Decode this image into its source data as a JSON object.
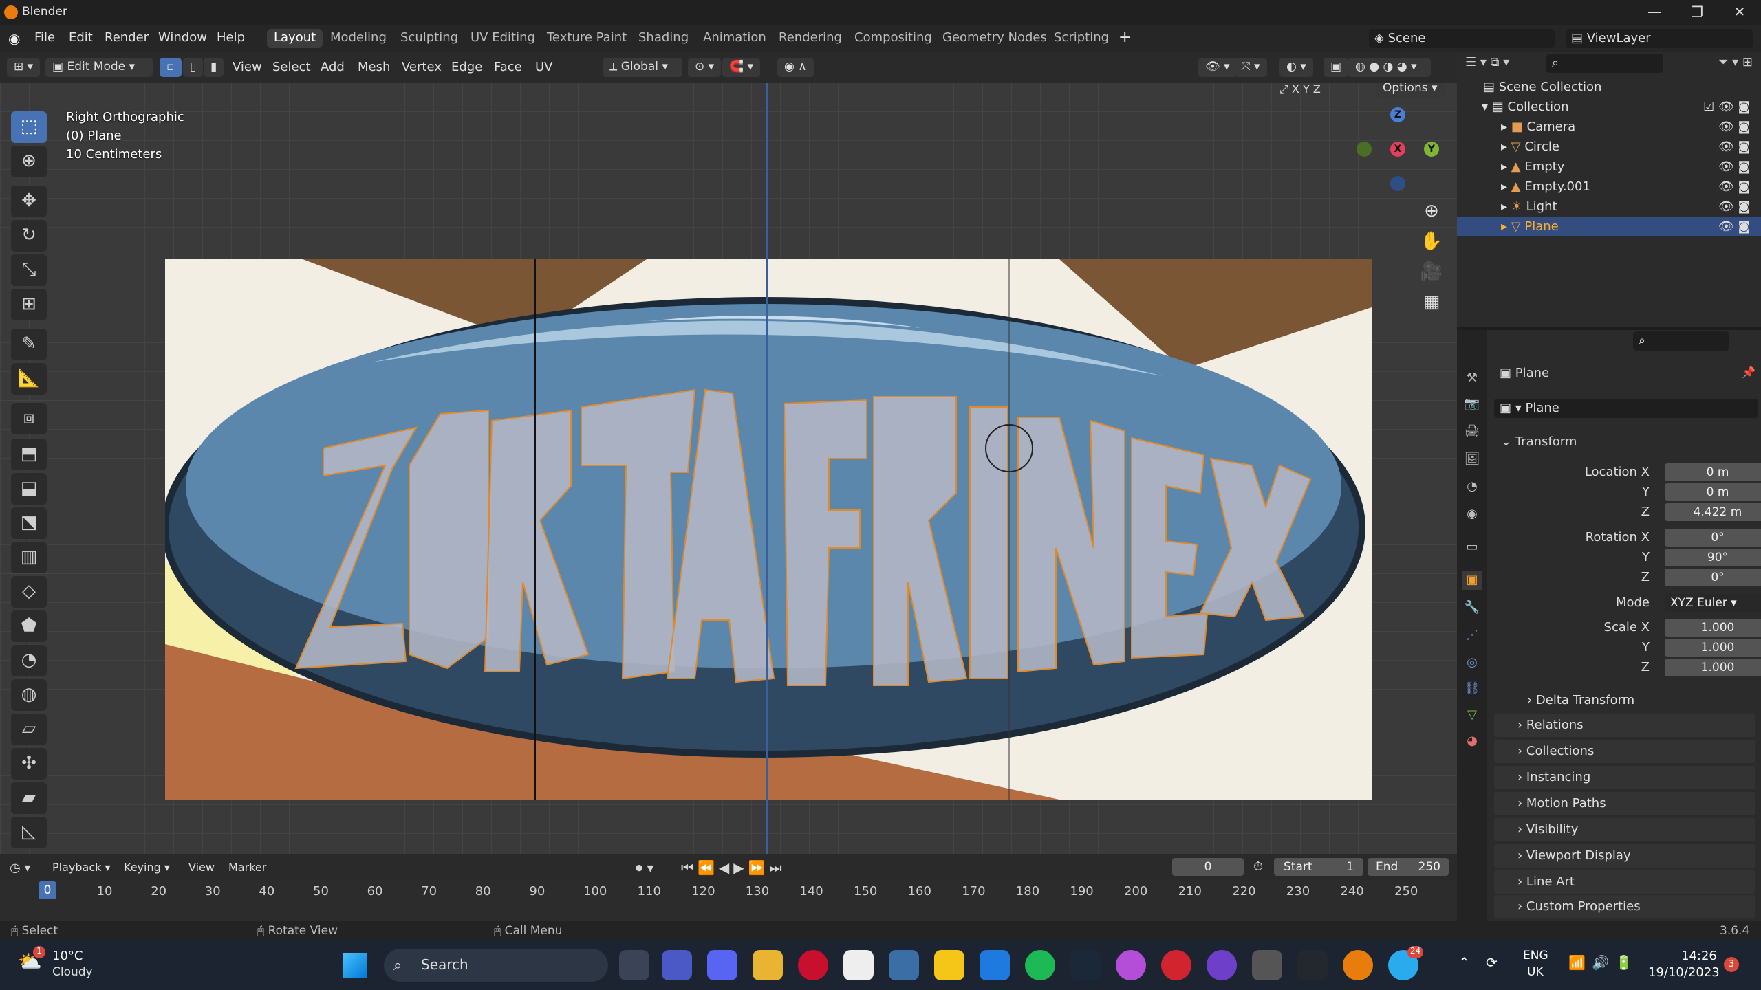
{
  "window": {
    "title": "Blender",
    "controls": [
      "—",
      "❐",
      "✕"
    ]
  },
  "menu": {
    "items": [
      "File",
      "Edit",
      "Render",
      "Window",
      "Help"
    ],
    "workspaces": [
      "Layout",
      "Modeling",
      "Sculpting",
      "UV Editing",
      "Texture Paint",
      "Shading",
      "Animation",
      "Rendering",
      "Compositing",
      "Geometry Nodes",
      "Scripting"
    ],
    "add": "+",
    "scene": "Scene",
    "view_layer": "ViewLayer"
  },
  "viewport_header": {
    "mode": "Edit Mode",
    "menus": [
      "View",
      "Select",
      "Add",
      "Mesh",
      "Vertex",
      "Edge",
      "Face",
      "UV"
    ],
    "orientation": "Global",
    "options": "Options",
    "axes": [
      "X",
      "Y",
      "Z"
    ]
  },
  "viewport": {
    "view_name": "Right Orthographic",
    "object": "(0) Plane",
    "scale": "10 Centimeters",
    "ref_text": "ZORTAFRINEX",
    "gizmo": {
      "z": "Z",
      "x": "X",
      "y": "Y"
    }
  },
  "outliner": {
    "root": "Scene Collection",
    "collection": "Collection",
    "objects": [
      {
        "name": "Camera",
        "icon": "camera-icon"
      },
      {
        "name": "Circle",
        "icon": "mesh-icon"
      },
      {
        "name": "Empty",
        "icon": "empty-icon"
      },
      {
        "name": "Empty.001",
        "icon": "empty-icon"
      },
      {
        "name": "Light",
        "icon": "light-icon"
      },
      {
        "name": "Plane",
        "icon": "mesh-icon",
        "selected": true
      }
    ]
  },
  "properties": {
    "object_name": "Plane",
    "data_name": "Plane",
    "transform": {
      "title": "Transform",
      "location": {
        "label": "Location X",
        "x": "0 m",
        "y": "0 m",
        "z": "4.422 m"
      },
      "rotation": {
        "label": "Rotation X",
        "x": "0°",
        "y": "90°",
        "z": "0°"
      },
      "mode_label": "Mode",
      "mode": "XYZ Euler",
      "scale": {
        "label": "Scale X",
        "x": "1.000",
        "y": "1.000",
        "z": "1.000"
      },
      "y_label": "Y",
      "z_label": "Z"
    },
    "panels": [
      "Delta Transform",
      "Relations",
      "Collections",
      "Instancing",
      "Motion Paths",
      "Visibility",
      "Viewport Display",
      "Line Art",
      "Custom Properties"
    ]
  },
  "timeline": {
    "menus": [
      "Playback",
      "Keying",
      "View",
      "Marker"
    ],
    "current": "0",
    "start_label": "Start",
    "start": "1",
    "end_label": "End",
    "end": "250",
    "ticks": [
      "0",
      "10",
      "20",
      "30",
      "40",
      "50",
      "60",
      "70",
      "80",
      "90",
      "100",
      "110",
      "120",
      "130",
      "140",
      "150",
      "160",
      "170",
      "180",
      "190",
      "200",
      "210",
      "220",
      "230",
      "240",
      "250"
    ]
  },
  "status": {
    "select": "Select",
    "rotate": "Rotate View",
    "menu": "Call Menu",
    "version": "3.6.4"
  },
  "taskbar": {
    "temp": "10°C",
    "weather": "Cloudy",
    "weather_badge": "1",
    "search": "Search",
    "lang1": "ENG",
    "lang2": "UK",
    "time": "14:26",
    "date": "19/10/2023",
    "notif": "3",
    "telegram_badge": "24"
  }
}
